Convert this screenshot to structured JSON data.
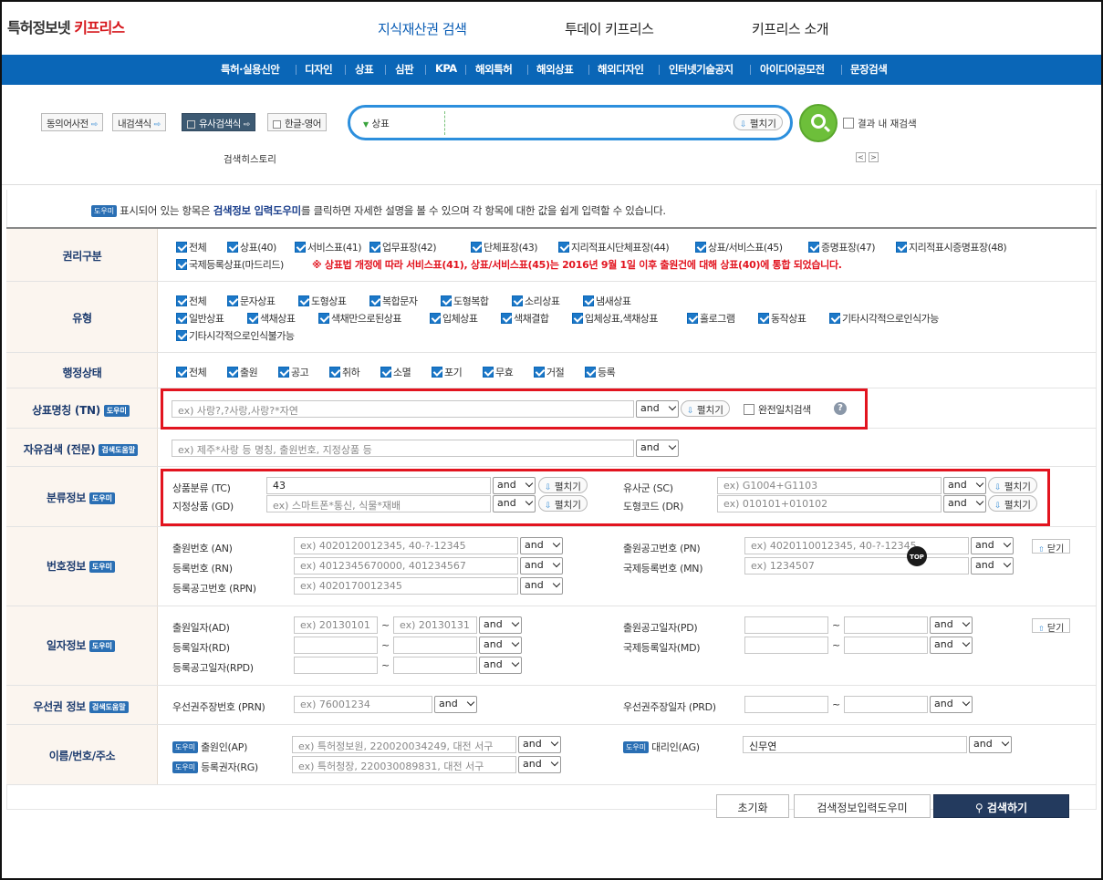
{
  "header": {
    "logo_prefix": "특허정보넷",
    "logo_brand": "키프리스",
    "nav": [
      "지식재산권 검색",
      "투데이 키프리스",
      "키프리스 소개"
    ]
  },
  "menu": [
    "특허·실용신안",
    "디자인",
    "상표",
    "심판",
    "KPA",
    "해외특허",
    "해외상표",
    "해외디자인",
    "인터넷기술공지",
    "아이디어공모전",
    "문장검색"
  ],
  "search": {
    "tools": [
      "동의어사전",
      "내검색식",
      "유사검색식",
      "한글-영어"
    ],
    "scope": "상표",
    "expand_label": "펼치기",
    "refine_label": "결과 내 재검색",
    "history_label": "검색히스토리",
    "prev": "<",
    "next": ">"
  },
  "icons": {
    "ext": "⇨",
    "down": "⇩",
    "up": "⇧"
  },
  "badges": {
    "helper": "도우미",
    "search_helper": "검색도움말"
  },
  "help_text": {
    "before": "표시되어 있는 항목은 ",
    "bold": "검색정보 입력도우미",
    "after": "를 클릭하면 자세한 설명을 볼 수 있으며 각 항목에 대한 값을 쉽게 입력할 수 있습니다."
  },
  "rights": {
    "label": "권리구분",
    "line1": [
      "전체",
      "상표(40)",
      "서비스표(41)",
      "업무표장(42)",
      "단체표장(43)",
      "지리적표시단체표장(44)",
      "상표/서비스표(45)",
      "증명표장(47)",
      "지리적표시증명표장(48)"
    ],
    "line2": [
      "국제등록상표(마드리드)"
    ],
    "notice": "※ 상표법 개정에 따라 서비스표(41), 상표/서비스표(45)는 2016년 9월 1일 이후 출원건에 대해 상표(40)에 통합 되었습니다."
  },
  "types": {
    "label": "유형",
    "line1": [
      "전체",
      "문자상표",
      "도형상표",
      "복합문자",
      "도형복합",
      "소리상표",
      "냄새상표"
    ],
    "line2": [
      "일반상표",
      "색채상표",
      "색채만으로된상표",
      "입체상표",
      "색채결합",
      "입체상표,색채상표",
      "홀로그램",
      "동작상표",
      "기타시각적으로인식가능"
    ],
    "line3": [
      "기타시각적으로인식불가능"
    ]
  },
  "status": {
    "label": "행정상태",
    "items": [
      "전체",
      "출원",
      "공고",
      "취하",
      "소멸",
      "포기",
      "무효",
      "거절",
      "등록"
    ]
  },
  "op": "and",
  "tn": {
    "label": "상표명칭 (TN)",
    "placeholder": "ex) 사랑?,?사랑,사랑?*자연",
    "exact_label": "완전일치검색",
    "help": "?"
  },
  "free": {
    "label": "자유검색 (전문)",
    "placeholder": "ex) 제주*사랑 등 명칭, 출원번호, 지정상품 등"
  },
  "cls": {
    "label": "분류정보",
    "tc_label": "상품분류 (TC)",
    "tc_value": "43",
    "gd_label": "지정상품 (GD)",
    "gd_placeholder": "ex) 스마트폰*통신, 식물*재배",
    "sc_label": "유사군 (SC)",
    "sc_placeholder": "ex) G1004+G1103",
    "dr_label": "도형코드 (DR)",
    "dr_placeholder": "ex) 010101+010102"
  },
  "num": {
    "label": "번호정보",
    "an_label": "출원번호 (AN)",
    "an_placeholder": "ex) 4020120012345, 40-?-12345",
    "rn_label": "등록번호 (RN)",
    "rn_placeholder": "ex) 4012345670000, 401234567",
    "rpn_label": "등록공고번호 (RPN)",
    "rpn_placeholder": "ex) 4020170012345",
    "pn_label": "출원공고번호 (PN)",
    "pn_placeholder": "ex) 4020110012345, 40-?-12345",
    "mn_label": "국제등록번호 (MN)",
    "mn_placeholder": "ex) 1234507",
    "close": "닫기"
  },
  "date": {
    "label": "일자정보",
    "ad_label": "출원일자(AD)",
    "ad_from": "ex) 20130101",
    "ad_to": "ex) 20130131",
    "rd_label": "등록일자(RD)",
    "rpd_label": "등록공고일자(RPD)",
    "pd_label": "출원공고일자(PD)",
    "md_label": "국제등록일자(MD)",
    "tilde": "~",
    "close": "닫기"
  },
  "prio": {
    "label": "우선권 정보",
    "prn_label": "우선권주장번호 (PRN)",
    "prn_placeholder": "ex) 76001234",
    "prd_label": "우선권주장일자 (PRD)"
  },
  "name": {
    "label": "이름/번호/주소",
    "ap_label": "출원인(AP)",
    "ap_placeholder": "ex) 특허정보원, 220020034249, 대전 서구",
    "rg_label": "등록권자(RG)",
    "rg_placeholder": "ex) 특허청장, 220030089831, 대전 서구",
    "ag_label": "대리인(AG)",
    "ag_value": "신무연"
  },
  "buttons": {
    "reset": "초기화",
    "helper": "검색정보입력도우미",
    "search": "검색하기"
  },
  "top_button": "TOP",
  "colors": {
    "accent": "#0a66b7",
    "brand_red": "#d6171c",
    "highlight": "#e2141f",
    "go": "#6dbf3a"
  }
}
